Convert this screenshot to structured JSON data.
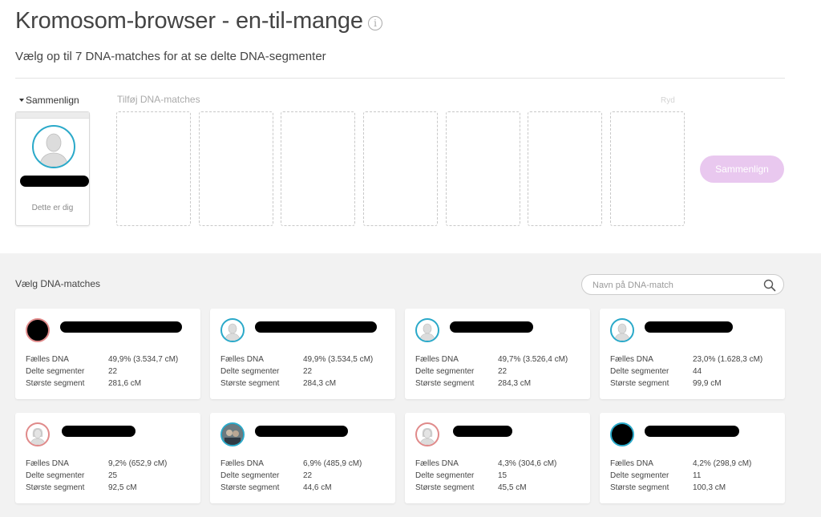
{
  "header": {
    "title": "Kromosom-browser - en-til-mange",
    "info_icon_glyph": "i",
    "subtitle": "Vælg op til 7 DNA-matches for at se delte DNA-segmenter"
  },
  "compare": {
    "label": "Sammenlign",
    "self_label": "Dette er dig",
    "add_label": "Tilføj DNA-matches",
    "clear_label": "Ryd",
    "button_label": "Sammenlign",
    "button_color": "#e9c8ef"
  },
  "matches": {
    "heading": "Vælg DNA-matches",
    "search_placeholder": "Navn på DNA-match",
    "labels": {
      "shared": "Fælles DNA",
      "segments": "Delte segmenter",
      "largest": "Største segment"
    },
    "cards": [
      {
        "shared": "49,9% (3.534,7 cM)",
        "segments": "22",
        "largest": "281,6 cM"
      },
      {
        "shared": "49,9% (3.534,5 cM)",
        "segments": "22",
        "largest": "284,3 cM"
      },
      {
        "shared": "49,7% (3.526,4 cM)",
        "segments": "22",
        "largest": "284,3 cM"
      },
      {
        "shared": "23,0% (1.628,3 cM)",
        "segments": "44",
        "largest": "99,9 cM"
      },
      {
        "shared": "9,2% (652,9 cM)",
        "segments": "25",
        "largest": "92,5 cM"
      },
      {
        "shared": "6,9% (485,9 cM)",
        "segments": "22",
        "largest": "44,6 cM"
      },
      {
        "shared": "4,3% (304,6 cM)",
        "segments": "15",
        "largest": "45,5 cM"
      },
      {
        "shared": "4,2% (298,9 cM)",
        "segments": "11",
        "largest": "100,3 cM"
      }
    ]
  },
  "colors": {
    "avatar_ring_male": "#2aa9c9",
    "avatar_ring_female": "#e08a8a"
  }
}
